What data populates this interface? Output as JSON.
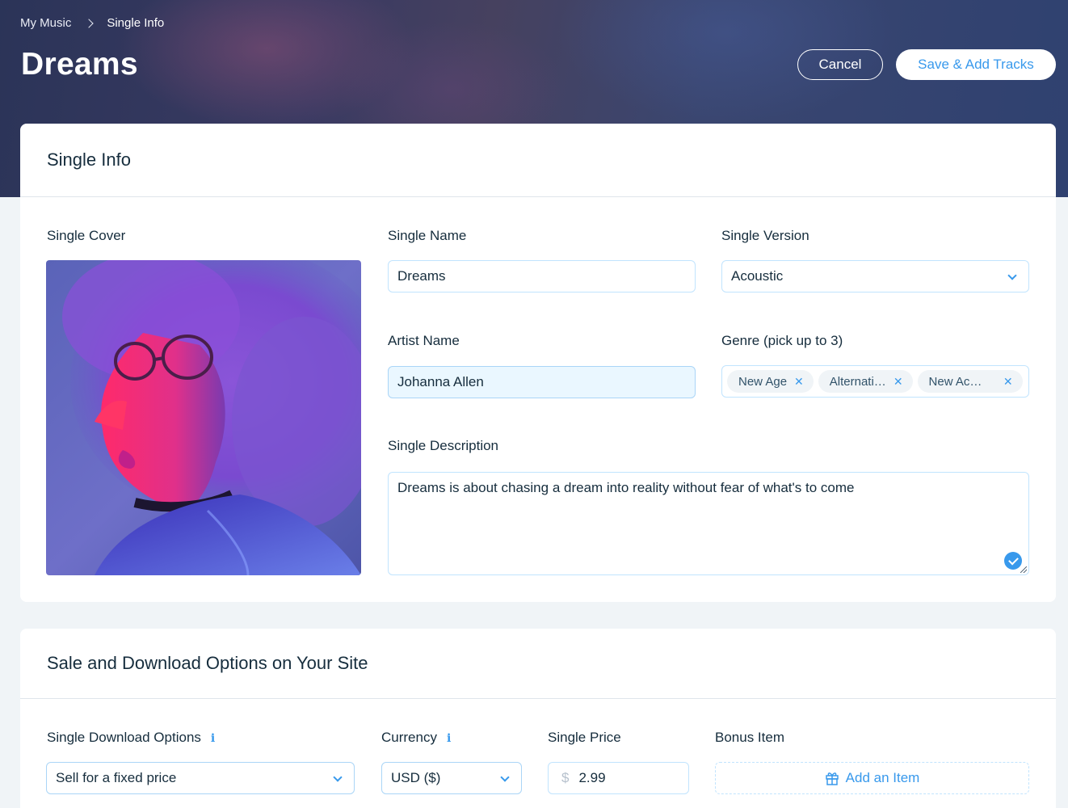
{
  "breadcrumb": {
    "root": "My Music",
    "current": "Single Info"
  },
  "page": {
    "title": "Dreams"
  },
  "actions": {
    "cancel_label": "Cancel",
    "save_label": "Save & Add Tracks"
  },
  "single_info": {
    "section_title": "Single Info",
    "cover_label": "Single Cover",
    "name_label": "Single Name",
    "name_value": "Dreams",
    "version_label": "Single Version",
    "version_value": "Acoustic",
    "artist_label": "Artist Name",
    "artist_value": "Johanna Allen",
    "genre_label": "Genre (pick up to 3)",
    "genres": [
      "New Age",
      "Alternati…",
      "New Ac…"
    ],
    "description_label": "Single Description",
    "description_value": "Dreams is about chasing a dream into reality without fear of what's to come"
  },
  "sale": {
    "section_title": "Sale and Download Options on Your Site",
    "download_label": "Single Download Options",
    "download_value": "Sell for a fixed price",
    "currency_label": "Currency",
    "currency_value": "USD ($)",
    "price_label": "Single Price",
    "price_symbol": "$",
    "price_value": "2.99",
    "bonus_label": "Bonus Item",
    "bonus_button": "Add an Item"
  },
  "colors": {
    "accent": "#3899ec",
    "text": "#162d3d",
    "field_border": "#c1e4fe"
  }
}
